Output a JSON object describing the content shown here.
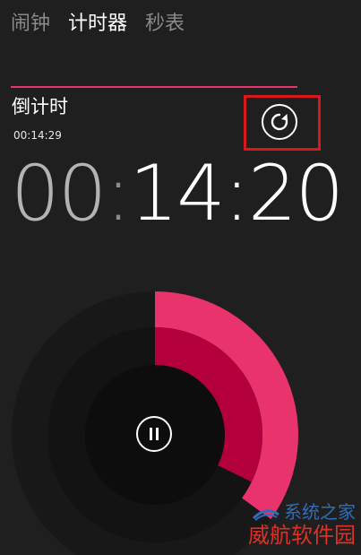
{
  "tabs": [
    {
      "label": "闹钟",
      "active": false
    },
    {
      "label": "计时器",
      "active": true
    },
    {
      "label": "秒表",
      "active": false
    }
  ],
  "timer": {
    "name": "倒计时",
    "set_duration": "00:14:29",
    "remaining_hours": "00",
    "remaining_rest": "14:20",
    "progress_remaining": 0.35
  },
  "icons": {
    "reset": "restart-icon",
    "pause": "pause-icon"
  },
  "colors": {
    "accent": "#e8336d",
    "accent_dark": "#b3003c",
    "highlight_box": "#d8191c"
  },
  "watermark": {
    "line1": "系统之家",
    "line2": "威航软件园"
  }
}
